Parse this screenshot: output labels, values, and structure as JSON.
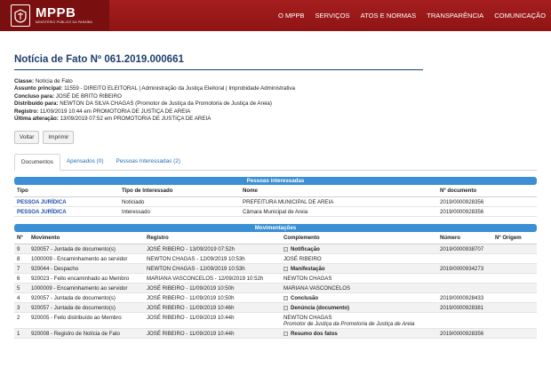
{
  "header": {
    "logo_title": "MPPB",
    "logo_subtitle": "MINISTÉRIO PÚBLICO DA PARAÍBA",
    "nav": [
      "O MPPB",
      "SERVIÇOS",
      "ATOS E NORMAS",
      "TRANSPARÊNCIA",
      "COMUNICAÇÃO"
    ]
  },
  "page": {
    "title": "Notícia de Fato Nº 061.2019.000661",
    "meta": [
      {
        "label": "Classe:",
        "value": "Notícia de Fato"
      },
      {
        "label": "Assunto principal:",
        "value": "11559 - DIREITO ELEITORAL | Administração da Justiça Eleitoral | Improbidade Administrativa"
      },
      {
        "label": "Concluso para:",
        "value": "JOSÉ DE BRITO RIBEIRO"
      },
      {
        "label": "Distribuído para:",
        "value": "NEWTON DA SILVA CHAGAS (Promotor de Justiça da Promotoria de Justiça de Areia)"
      },
      {
        "label": "Registro:",
        "value": "11/09/2019 10:44 em PROMOTORIA DE JUSTIÇA DE AREIA"
      },
      {
        "label": "Última alteração:",
        "value": "13/09/2019 07:52 em PROMOTORIA DE JUSTIÇA DE AREIA"
      }
    ],
    "buttons": {
      "back": "Voltar",
      "print": "Imprimir"
    },
    "tabs": [
      "Documentos",
      "Apensados (0)",
      "Pessoas Interessadas (2)"
    ]
  },
  "pessoas": {
    "title": "Pessoas interessadas",
    "headers": [
      "Tipo",
      "Tipo de Interessado",
      "Nome",
      "Nº documento"
    ],
    "rows": [
      [
        "PESSOA JURÍDICA",
        "Noticiado",
        "PREFEITURA MUNICIPAL DE AREIA",
        "2019/0000928356"
      ],
      [
        "PESSOA JURÍDICA",
        "Interessado",
        "Câmara Municipal de Areia",
        "2019/0000928356"
      ]
    ]
  },
  "movimentacoes": {
    "title": "Movimentações",
    "headers": [
      "Nº",
      "Movimento",
      "Registro",
      "Complemento",
      "Número",
      "Nº Origem"
    ],
    "rows": [
      {
        "n": "9",
        "mov": "920057 - Juntada de documento(s)",
        "reg": "JOSÉ RIBEIRO - 13/09/2019 07:52h",
        "comp": "Notificação",
        "comp_icon": true,
        "comp_bold": true,
        "comp2": "",
        "num": "2019/0000938707",
        "orig": ""
      },
      {
        "n": "8",
        "mov": "1000009 - Encaminhamento ao servidor",
        "reg": "NEWTON CHAGAS - 12/09/2019 10:53h",
        "comp": "JOSÉ RIBEIRO",
        "comp_icon": false,
        "comp_bold": false,
        "comp2": "",
        "num": "",
        "orig": ""
      },
      {
        "n": "7",
        "mov": "920044 - Despacho",
        "reg": "NEWTON CHAGAS - 12/09/2019 10:53h",
        "comp": "Manifestação",
        "comp_icon": true,
        "comp_bold": true,
        "comp2": "",
        "num": "2019/0000934273",
        "orig": ""
      },
      {
        "n": "6",
        "mov": "920023 - Feito encaminhado ao Membro",
        "reg": "MARIANA VASCONCELOS - 12/09/2019 10:52h",
        "comp": "NEWTON CHAGAS",
        "comp_icon": false,
        "comp_bold": false,
        "comp2": "",
        "num": "",
        "orig": ""
      },
      {
        "n": "5",
        "mov": "1000009 - Encaminhamento ao servidor",
        "reg": "JOSÉ RIBEIRO - 11/09/2019 10:50h",
        "comp": "MARIANA VASCONCELOS",
        "comp_icon": false,
        "comp_bold": false,
        "comp2": "",
        "num": "",
        "orig": ""
      },
      {
        "n": "4",
        "mov": "920057 - Juntada de documento(s)",
        "reg": "JOSÉ RIBEIRO - 11/09/2019 10:50h",
        "comp": "Conclusão",
        "comp_icon": true,
        "comp_bold": true,
        "comp2": "",
        "num": "2019/0000928433",
        "orig": ""
      },
      {
        "n": "3",
        "mov": "920057 - Juntada de documento(s)",
        "reg": "JOSÉ RIBEIRO - 11/09/2019 10:46h",
        "comp": "Denúncia (documento)",
        "comp_icon": true,
        "comp_bold": true,
        "comp2": "",
        "num": "2019/0000928381",
        "orig": ""
      },
      {
        "n": "2",
        "mov": "920005 - Feito distribuído ao Membro",
        "reg": "JOSÉ RIBEIRO - 11/09/2019 10:44h",
        "comp": "NEWTON CHAGAS",
        "comp_icon": false,
        "comp_bold": false,
        "comp2": "Promotor de Justiça da Promotoria de Justiça de Areia",
        "num": "",
        "orig": ""
      },
      {
        "n": "1",
        "mov": "920008 - Registro de Notícia de Fato",
        "reg": "JOSÉ RIBEIRO - 11/09/2019 10:44h",
        "comp": "Resumo dos fatos",
        "comp_icon": true,
        "comp_bold": true,
        "comp2": "",
        "num": "2019/0000928356",
        "orig": ""
      }
    ]
  },
  "colors": {
    "header": "#9c1a1a",
    "accent": "#3b8fd4",
    "title": "#1f3f6e"
  },
  "icons": {
    "logo": "mp-emblem-icon",
    "doc": "document-icon"
  }
}
